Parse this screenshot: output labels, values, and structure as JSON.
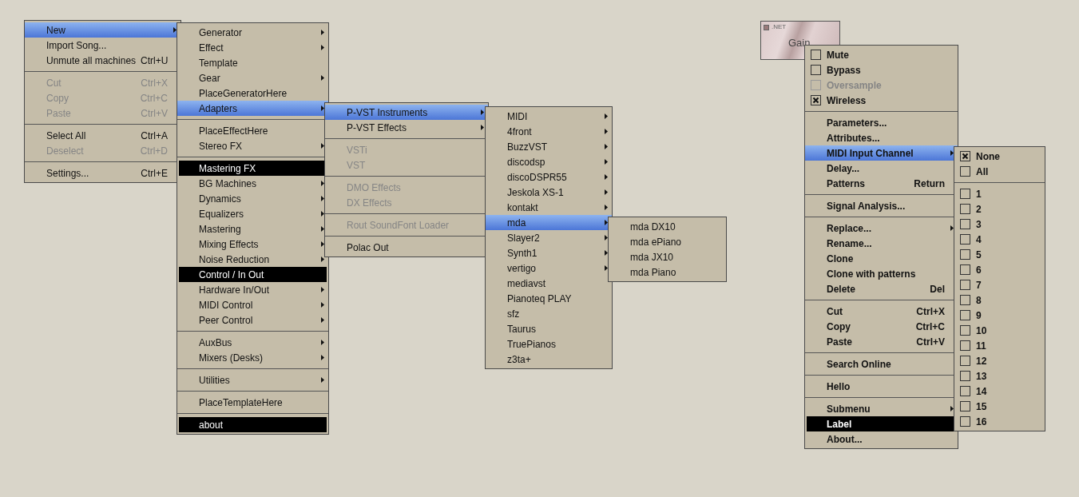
{
  "node": {
    "badge": ".NET",
    "title": "Gain"
  },
  "menus": [
    {
      "items": [
        {
          "kind": "item",
          "label": "New",
          "selected": true,
          "disabled": false,
          "submenu": true
        },
        {
          "kind": "item",
          "label": "Import Song...",
          "selected": false,
          "disabled": false,
          "submenu": false
        },
        {
          "kind": "item",
          "label": "Unmute all machines",
          "shortcut": "Ctrl+U",
          "selected": false,
          "disabled": false,
          "submenu": false
        },
        {
          "kind": "separator"
        },
        {
          "kind": "item",
          "label": "Cut",
          "shortcut": "Ctrl+X",
          "selected": false,
          "disabled": true,
          "submenu": false
        },
        {
          "kind": "item",
          "label": "Copy",
          "shortcut": "Ctrl+C",
          "selected": false,
          "disabled": true,
          "submenu": false
        },
        {
          "kind": "item",
          "label": "Paste",
          "shortcut": "Ctrl+V",
          "selected": false,
          "disabled": true,
          "submenu": false
        },
        {
          "kind": "separator"
        },
        {
          "kind": "item",
          "label": "Select All",
          "shortcut": "Ctrl+A",
          "selected": false,
          "disabled": false,
          "submenu": false
        },
        {
          "kind": "item",
          "label": "Deselect",
          "shortcut": "Ctrl+D",
          "selected": false,
          "disabled": true,
          "submenu": false
        },
        {
          "kind": "separator"
        },
        {
          "kind": "item",
          "label": "Settings...",
          "shortcut": "Ctrl+E",
          "selected": false,
          "disabled": false,
          "submenu": false
        }
      ]
    },
    {
      "items": [
        {
          "kind": "item",
          "label": "Generator",
          "selected": false,
          "disabled": false,
          "submenu": true
        },
        {
          "kind": "item",
          "label": "Effect",
          "selected": false,
          "disabled": false,
          "submenu": true
        },
        {
          "kind": "item",
          "label": "Template",
          "selected": false,
          "disabled": false,
          "submenu": false
        },
        {
          "kind": "item",
          "label": "Gear",
          "selected": false,
          "disabled": false,
          "submenu": true
        },
        {
          "kind": "item",
          "label": "PlaceGeneratorHere",
          "selected": false,
          "disabled": false,
          "submenu": false
        },
        {
          "kind": "item",
          "label": "Adapters",
          "selected": true,
          "disabled": false,
          "submenu": true
        },
        {
          "kind": "separator"
        },
        {
          "kind": "item",
          "label": "PlaceEffectHere",
          "selected": false,
          "disabled": false,
          "submenu": false
        },
        {
          "kind": "item",
          "label": "Stereo FX",
          "selected": false,
          "disabled": false,
          "submenu": true
        },
        {
          "kind": "separator"
        },
        {
          "kind": "label",
          "label": "Mastering FX"
        },
        {
          "kind": "item",
          "label": "BG Machines",
          "selected": false,
          "disabled": false,
          "submenu": true
        },
        {
          "kind": "item",
          "label": "Dynamics",
          "selected": false,
          "disabled": false,
          "submenu": true
        },
        {
          "kind": "item",
          "label": "Equalizers",
          "selected": false,
          "disabled": false,
          "submenu": true
        },
        {
          "kind": "item",
          "label": "Mastering",
          "selected": false,
          "disabled": false,
          "submenu": true
        },
        {
          "kind": "item",
          "label": "Mixing Effects",
          "selected": false,
          "disabled": false,
          "submenu": true
        },
        {
          "kind": "item",
          "label": "Noise Reduction",
          "selected": false,
          "disabled": false,
          "submenu": true
        },
        {
          "kind": "label",
          "label": "Control / In Out"
        },
        {
          "kind": "item",
          "label": "Hardware In/Out",
          "selected": false,
          "disabled": false,
          "submenu": true
        },
        {
          "kind": "item",
          "label": "MIDI Control",
          "selected": false,
          "disabled": false,
          "submenu": true
        },
        {
          "kind": "item",
          "label": "Peer Control",
          "selected": false,
          "disabled": false,
          "submenu": true
        },
        {
          "kind": "separator"
        },
        {
          "kind": "item",
          "label": "AuxBus",
          "selected": false,
          "disabled": false,
          "submenu": true
        },
        {
          "kind": "item",
          "label": "Mixers (Desks)",
          "selected": false,
          "disabled": false,
          "submenu": true
        },
        {
          "kind": "separator"
        },
        {
          "kind": "item",
          "label": "Utilities",
          "selected": false,
          "disabled": false,
          "submenu": true
        },
        {
          "kind": "separator"
        },
        {
          "kind": "item",
          "label": "PlaceTemplateHere",
          "selected": false,
          "disabled": false,
          "submenu": false
        },
        {
          "kind": "separator"
        },
        {
          "kind": "label",
          "label": "about"
        }
      ]
    },
    {
      "items": [
        {
          "kind": "item",
          "label": "P-VST Instruments",
          "selected": true,
          "disabled": false,
          "submenu": true
        },
        {
          "kind": "item",
          "label": "P-VST Effects",
          "selected": false,
          "disabled": false,
          "submenu": true
        },
        {
          "kind": "separator"
        },
        {
          "kind": "item",
          "label": "VSTi",
          "selected": false,
          "disabled": true,
          "submenu": false
        },
        {
          "kind": "item",
          "label": "VST",
          "selected": false,
          "disabled": true,
          "submenu": false
        },
        {
          "kind": "separator"
        },
        {
          "kind": "item",
          "label": "DMO Effects",
          "selected": false,
          "disabled": true,
          "submenu": false
        },
        {
          "kind": "item",
          "label": "DX Effects",
          "selected": false,
          "disabled": true,
          "submenu": false
        },
        {
          "kind": "separator"
        },
        {
          "kind": "item",
          "label": "Rout SoundFont Loader",
          "selected": false,
          "disabled": true,
          "submenu": false
        },
        {
          "kind": "separator"
        },
        {
          "kind": "item",
          "label": "Polac Out",
          "selected": false,
          "disabled": false,
          "submenu": false
        }
      ]
    },
    {
      "items": [
        {
          "kind": "item",
          "label": "MIDI",
          "selected": false,
          "disabled": false,
          "submenu": true
        },
        {
          "kind": "item",
          "label": "4front",
          "selected": false,
          "disabled": false,
          "submenu": true
        },
        {
          "kind": "item",
          "label": "BuzzVST",
          "selected": false,
          "disabled": false,
          "submenu": true
        },
        {
          "kind": "item",
          "label": "discodsp",
          "selected": false,
          "disabled": false,
          "submenu": true
        },
        {
          "kind": "item",
          "label": "discoDSPR55",
          "selected": false,
          "disabled": false,
          "submenu": true
        },
        {
          "kind": "item",
          "label": "Jeskola XS-1",
          "selected": false,
          "disabled": false,
          "submenu": true
        },
        {
          "kind": "item",
          "label": "kontakt",
          "selected": false,
          "disabled": false,
          "submenu": true
        },
        {
          "kind": "item",
          "label": "mda",
          "selected": true,
          "disabled": false,
          "submenu": true
        },
        {
          "kind": "item",
          "label": "Slayer2",
          "selected": false,
          "disabled": false,
          "submenu": true
        },
        {
          "kind": "item",
          "label": "Synth1",
          "selected": false,
          "disabled": false,
          "submenu": true
        },
        {
          "kind": "item",
          "label": "vertigo",
          "selected": false,
          "disabled": false,
          "submenu": true
        },
        {
          "kind": "item",
          "label": "mediavst",
          "selected": false,
          "disabled": false,
          "submenu": false
        },
        {
          "kind": "item",
          "label": "Pianoteq PLAY",
          "selected": false,
          "disabled": false,
          "submenu": false
        },
        {
          "kind": "item",
          "label": "sfz",
          "selected": false,
          "disabled": false,
          "submenu": false
        },
        {
          "kind": "item",
          "label": "Taurus",
          "selected": false,
          "disabled": false,
          "submenu": false
        },
        {
          "kind": "item",
          "label": "TruePianos",
          "selected": false,
          "disabled": false,
          "submenu": false
        },
        {
          "kind": "item",
          "label": "z3ta+",
          "selected": false,
          "disabled": false,
          "submenu": false
        }
      ]
    },
    {
      "items": [
        {
          "kind": "item",
          "label": "mda DX10",
          "selected": false,
          "disabled": false,
          "submenu": false
        },
        {
          "kind": "item",
          "label": "mda ePiano",
          "selected": false,
          "disabled": false,
          "submenu": false
        },
        {
          "kind": "item",
          "label": "mda JX10",
          "selected": false,
          "disabled": false,
          "submenu": false
        },
        {
          "kind": "item",
          "label": "mda Piano",
          "selected": false,
          "disabled": false,
          "submenu": false
        }
      ]
    },
    {
      "items": [
        {
          "kind": "check",
          "label": "Mute",
          "checked": false,
          "disabled": false
        },
        {
          "kind": "check",
          "label": "Bypass",
          "checked": false,
          "disabled": false
        },
        {
          "kind": "check",
          "label": "Oversample",
          "checked": false,
          "disabled": true
        },
        {
          "kind": "check",
          "label": "Wireless",
          "checked": true,
          "disabled": false
        },
        {
          "kind": "separator"
        },
        {
          "kind": "item",
          "label": "Parameters...",
          "selected": false,
          "disabled": false,
          "submenu": false
        },
        {
          "kind": "item",
          "label": "Attributes...",
          "selected": false,
          "disabled": false,
          "submenu": false
        },
        {
          "kind": "item",
          "label": "MIDI Input Channel",
          "selected": true,
          "disabled": false,
          "submenu": true
        },
        {
          "kind": "item",
          "label": "Delay...",
          "selected": false,
          "disabled": false,
          "submenu": false
        },
        {
          "kind": "item",
          "label": "Patterns",
          "shortcut": "Return",
          "selected": false,
          "disabled": false,
          "submenu": false
        },
        {
          "kind": "separator"
        },
        {
          "kind": "item",
          "label": "Signal Analysis...",
          "selected": false,
          "disabled": false,
          "submenu": false
        },
        {
          "kind": "separator"
        },
        {
          "kind": "item",
          "label": "Replace...",
          "selected": false,
          "disabled": false,
          "submenu": true
        },
        {
          "kind": "item",
          "label": "Rename...",
          "selected": false,
          "disabled": false,
          "submenu": false
        },
        {
          "kind": "item",
          "label": "Clone",
          "selected": false,
          "disabled": false,
          "submenu": false
        },
        {
          "kind": "item",
          "label": "Clone with patterns",
          "selected": false,
          "disabled": false,
          "submenu": false
        },
        {
          "kind": "item",
          "label": "Delete",
          "shortcut": "Del",
          "selected": false,
          "disabled": false,
          "submenu": false
        },
        {
          "kind": "separator"
        },
        {
          "kind": "item",
          "label": "Cut",
          "shortcut": "Ctrl+X",
          "selected": false,
          "disabled": false,
          "submenu": false
        },
        {
          "kind": "item",
          "label": "Copy",
          "shortcut": "Ctrl+C",
          "selected": false,
          "disabled": false,
          "submenu": false
        },
        {
          "kind": "item",
          "label": "Paste",
          "shortcut": "Ctrl+V",
          "selected": false,
          "disabled": false,
          "submenu": false
        },
        {
          "kind": "separator"
        },
        {
          "kind": "item",
          "label": "Search Online",
          "selected": false,
          "disabled": false,
          "submenu": false
        },
        {
          "kind": "separator"
        },
        {
          "kind": "item",
          "label": "Hello",
          "selected": false,
          "disabled": false,
          "submenu": false
        },
        {
          "kind": "separator"
        },
        {
          "kind": "item",
          "label": "Submenu",
          "selected": false,
          "disabled": false,
          "submenu": true
        },
        {
          "kind": "label",
          "label": "Label"
        },
        {
          "kind": "item",
          "label": "About...",
          "selected": false,
          "disabled": false,
          "submenu": false
        }
      ]
    },
    {
      "items": [
        {
          "kind": "check",
          "label": "None",
          "checked": true,
          "disabled": false
        },
        {
          "kind": "check",
          "label": "All",
          "checked": false,
          "disabled": false
        },
        {
          "kind": "separator"
        },
        {
          "kind": "check",
          "label": "1",
          "checked": false,
          "disabled": false
        },
        {
          "kind": "check",
          "label": "2",
          "checked": false,
          "disabled": false
        },
        {
          "kind": "check",
          "label": "3",
          "checked": false,
          "disabled": false
        },
        {
          "kind": "check",
          "label": "4",
          "checked": false,
          "disabled": false
        },
        {
          "kind": "check",
          "label": "5",
          "checked": false,
          "disabled": false
        },
        {
          "kind": "check",
          "label": "6",
          "checked": false,
          "disabled": false
        },
        {
          "kind": "check",
          "label": "7",
          "checked": false,
          "disabled": false
        },
        {
          "kind": "check",
          "label": "8",
          "checked": false,
          "disabled": false
        },
        {
          "kind": "check",
          "label": "9",
          "checked": false,
          "disabled": false
        },
        {
          "kind": "check",
          "label": "10",
          "checked": false,
          "disabled": false
        },
        {
          "kind": "check",
          "label": "11",
          "checked": false,
          "disabled": false
        },
        {
          "kind": "check",
          "label": "12",
          "checked": false,
          "disabled": false
        },
        {
          "kind": "check",
          "label": "13",
          "checked": false,
          "disabled": false
        },
        {
          "kind": "check",
          "label": "14",
          "checked": false,
          "disabled": false
        },
        {
          "kind": "check",
          "label": "15",
          "checked": false,
          "disabled": false
        },
        {
          "kind": "check",
          "label": "16",
          "checked": false,
          "disabled": false
        }
      ]
    }
  ]
}
